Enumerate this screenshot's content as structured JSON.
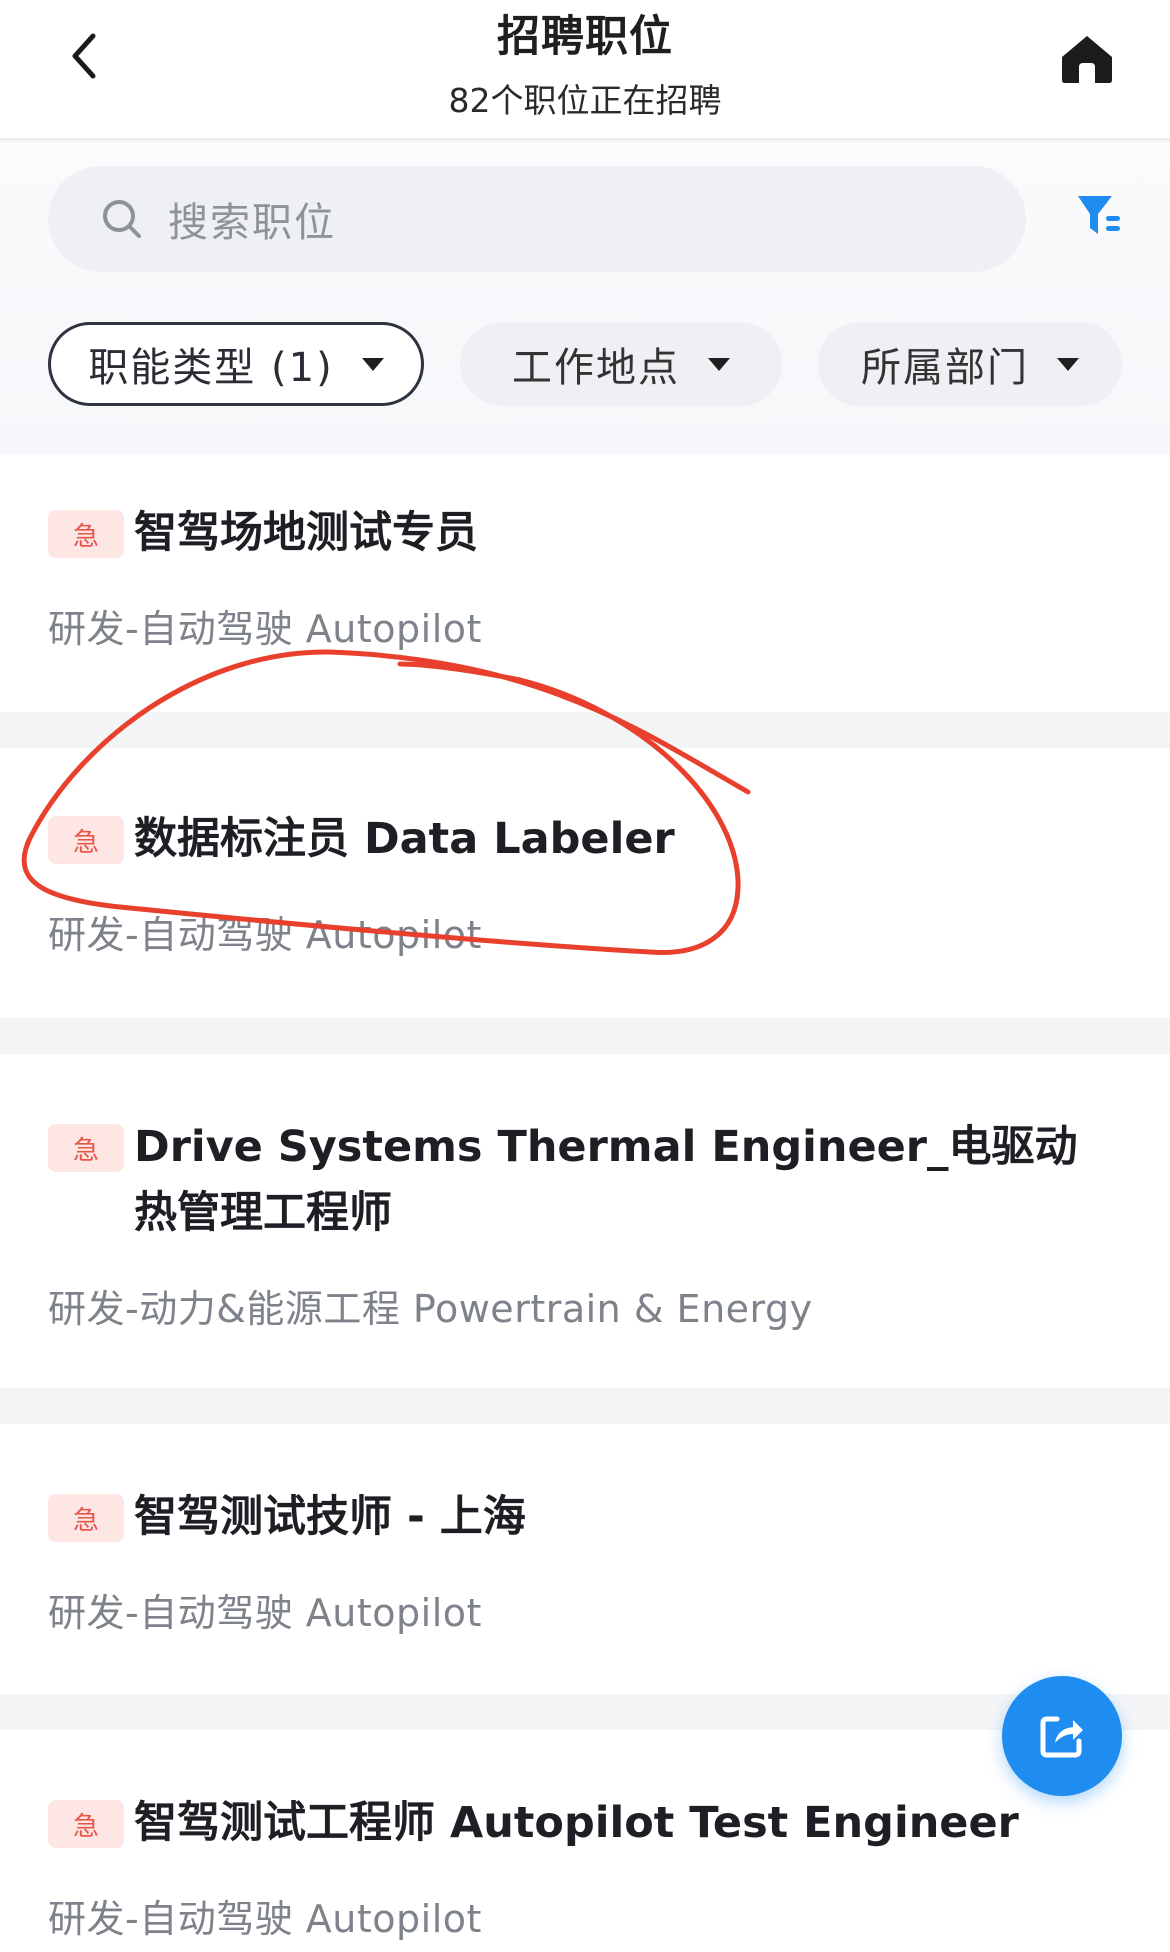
{
  "header": {
    "title": "招聘职位",
    "subtitle": "82个职位正在招聘"
  },
  "search": {
    "placeholder": "搜索职位"
  },
  "filters": [
    {
      "label": "职能类型 (1)",
      "active": true
    },
    {
      "label": "工作地点",
      "active": false
    },
    {
      "label": "所属部门",
      "active": false
    }
  ],
  "jobs": [
    {
      "badge": "急",
      "title": "智驾场地测试专员",
      "department": "研发-自动驾驶 Autopilot"
    },
    {
      "badge": "急",
      "title": "数据标注员 Data Labeler",
      "department": "研发-自动驾驶 Autopilot"
    },
    {
      "badge": "急",
      "title": "Drive Systems Thermal Engineer_电驱动热管理工程师",
      "department": "研发-动力&能源工程 Powertrain & Energy"
    },
    {
      "badge": "急",
      "title": "智驾测试技师 - 上海",
      "department": "研发-自动驾驶 Autopilot"
    },
    {
      "badge": "急",
      "title": "智驾测试工程师 Autopilot Test Engineer",
      "department": "研发-自动驾驶 Autopilot"
    }
  ],
  "colors": {
    "accent": "#1f8cf0",
    "badge_bg": "#fde6e4",
    "badge_text": "#e8564a",
    "annotation": "#e8402c"
  },
  "icons": {
    "back": "chevron-left-icon",
    "home": "home-icon",
    "search": "search-icon",
    "filter": "filter-icon",
    "share": "share-icon"
  }
}
